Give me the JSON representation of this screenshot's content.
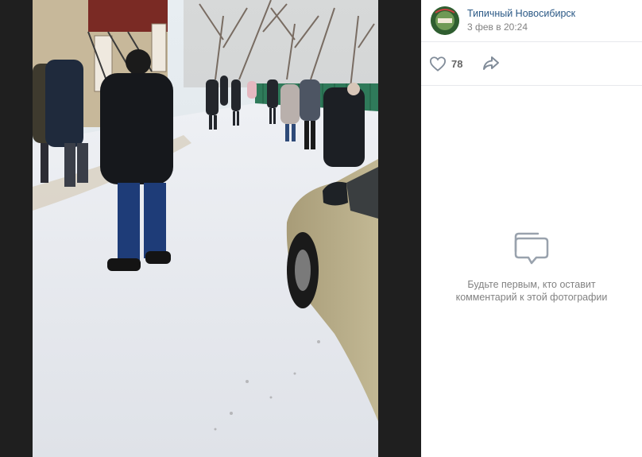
{
  "post": {
    "author": "Типичный Новосибирск",
    "time": "3 фев в 20:24",
    "avatar_icon": "community-avatar-icon"
  },
  "actions": {
    "like_icon": "heart-icon",
    "like_count": "78",
    "share_icon": "share-arrow-icon"
  },
  "comments": {
    "empty_icon": "speech-bubbles-icon",
    "empty_line1": "Будьте первым, кто оставит",
    "empty_line2": "комментарий к этой фотографии"
  },
  "photo": {
    "description_icon": "photo-winter-queue"
  },
  "colors": {
    "link": "#2a5885",
    "muted": "#828282",
    "icon": "#818c99",
    "backdrop": "#1f1f1f"
  }
}
